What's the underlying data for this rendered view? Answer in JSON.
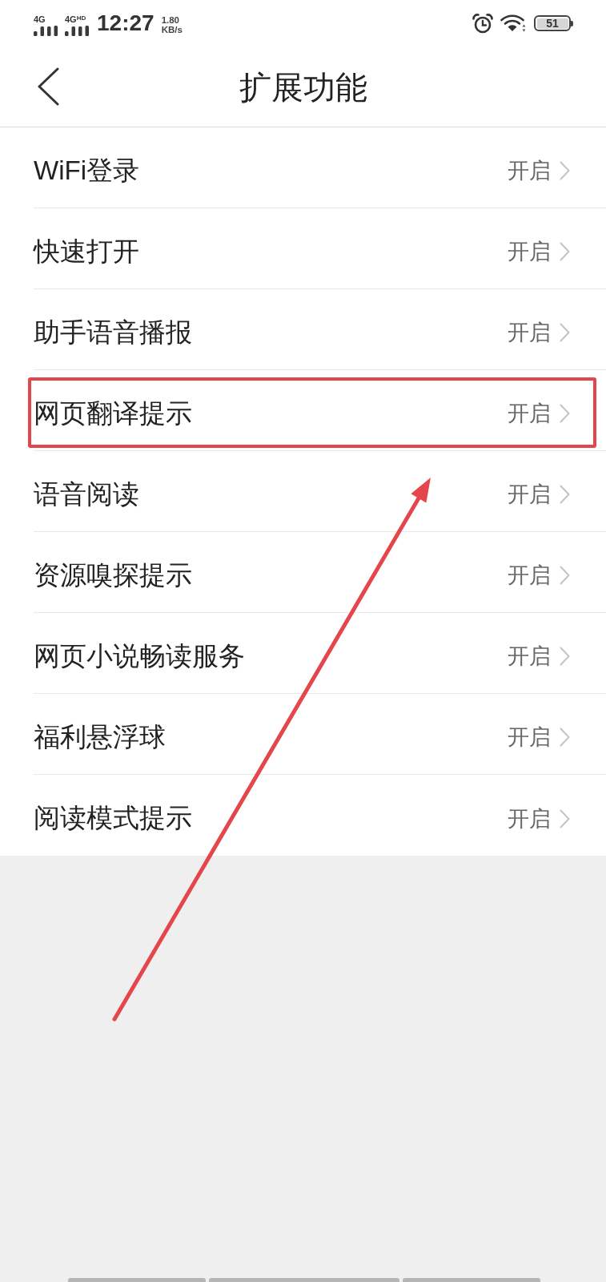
{
  "status_bar": {
    "signals": [
      {
        "label": "4G"
      },
      {
        "label": "4G$^{HD}$"
      }
    ],
    "time": "12:27",
    "speed": {
      "value": "1.80",
      "unit": "KB/s"
    },
    "battery": "51"
  },
  "header": {
    "title": "扩展功能"
  },
  "rows": [
    {
      "label": "WiFi登录",
      "value": "开启",
      "highlighted": false
    },
    {
      "label": "快速打开",
      "value": "开启",
      "highlighted": false
    },
    {
      "label": "助手语音播报",
      "value": "开启",
      "highlighted": false
    },
    {
      "label": "网页翻译提示",
      "value": "开启",
      "highlighted": true
    },
    {
      "label": "语音阅读",
      "value": "开启",
      "highlighted": false
    },
    {
      "label": "资源嗅探提示",
      "value": "开启",
      "highlighted": false
    },
    {
      "label": "网页小说畅读服务",
      "value": "开启",
      "highlighted": false
    },
    {
      "label": "福利悬浮球",
      "value": "开启",
      "highlighted": false
    },
    {
      "label": "阅读模式提示",
      "value": "开启",
      "highlighted": false
    }
  ]
}
